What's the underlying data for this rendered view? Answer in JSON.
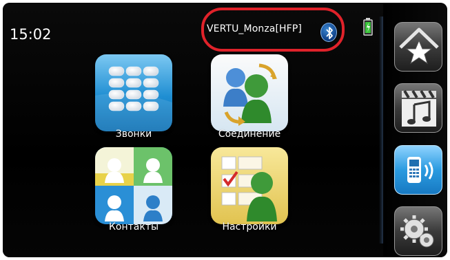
{
  "status_bar": {
    "time": "15:02",
    "device_name": "VERTU_Monza[HFP]",
    "bluetooth_icon": "bluetooth-icon",
    "battery_icon": "battery-charging-icon"
  },
  "apps": [
    {
      "label": "Звонки",
      "icon": "dialpad-icon"
    },
    {
      "label": "Соединение",
      "icon": "connection-icon"
    },
    {
      "label": "Контакты",
      "icon": "contacts-icon"
    },
    {
      "label": "Настройки",
      "icon": "settings-list-icon"
    }
  ],
  "sidebar": [
    {
      "icon": "favorites-star-icon",
      "active": false
    },
    {
      "icon": "media-clapper-music-icon",
      "active": false
    },
    {
      "icon": "phone-call-icon",
      "active": true
    },
    {
      "icon": "gears-icon",
      "active": false
    }
  ],
  "colors": {
    "highlight_oval": "#e0222a",
    "active_button": "#2b9be0",
    "bluetooth": "#1f5fb0"
  }
}
